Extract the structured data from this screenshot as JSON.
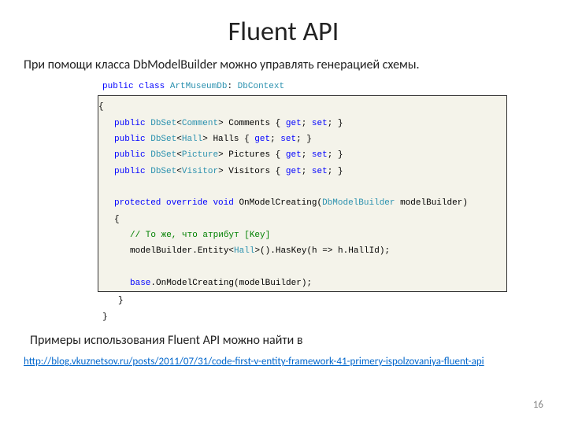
{
  "title": "Fluent API",
  "subtitle": "При помощи класса DbModelBuilder можно управлять генерацией схемы.",
  "code": {
    "l1_kw1": "public",
    "l1_kw2": "class",
    "l1_type": "ArtMuseumDb",
    "l1_sep": ": ",
    "l1_base": "DbContext",
    "l2": "{",
    "l3_kw": "public",
    "l3_type": "DbSet",
    "l3_gopen": "<",
    "l3_gen": "Comment",
    "l3_gclose": ">",
    "l3_name": " Comments { ",
    "l3_get": "get",
    "l3_sc1": "; ",
    "l3_set": "set",
    "l3_sc2": "; }",
    "l4_kw": "public",
    "l4_type": "DbSet",
    "l4_gopen": "<",
    "l4_gen": "Hall",
    "l4_gclose": ">",
    "l4_name": " Halls { ",
    "l4_get": "get",
    "l4_sc1": "; ",
    "l4_set": "set",
    "l4_sc2": "; }",
    "l5_kw": "public",
    "l5_type": "DbSet",
    "l5_gopen": "<",
    "l5_gen": "Picture",
    "l5_gclose": ">",
    "l5_name": " Pictures { ",
    "l5_get": "get",
    "l5_sc1": "; ",
    "l5_set": "set",
    "l5_sc2": "; }",
    "l6_kw": "public",
    "l6_type": "DbSet",
    "l6_gopen": "<",
    "l6_gen": "Visitor",
    "l6_gclose": ">",
    "l6_name": " Visitors { ",
    "l6_get": "get",
    "l6_sc1": "; ",
    "l6_set": "set",
    "l6_sc2": "; }",
    "l7_sp": " ",
    "l8_kw1": "protected",
    "l8_kw2": "override",
    "l8_kw3": "void",
    "l8_name": " OnModelCreating(",
    "l8_ptype": "DbModelBuilder",
    "l8_pname": " modelBuilder)",
    "l9": "{",
    "l10_cm": "// То же, что атрибут [Key]",
    "l11_a": "modelBuilder.Entity<",
    "l11_gen": "Hall",
    "l11_b": ">().HasKey(h => h.HallId);",
    "l12_sp": " ",
    "l13_kw": "base",
    "l13_rest": ".OnModelCreating(modelBuilder);",
    "l14": "}",
    "l15": "}"
  },
  "footer": "Примеры использования Fluent API можно найти в",
  "link": "http://blog.vkuznetsov.ru/posts/2011/07/31/code-first-v-entity-framework-41-primery-ispolzovaniya-fluent-api",
  "page": "16"
}
